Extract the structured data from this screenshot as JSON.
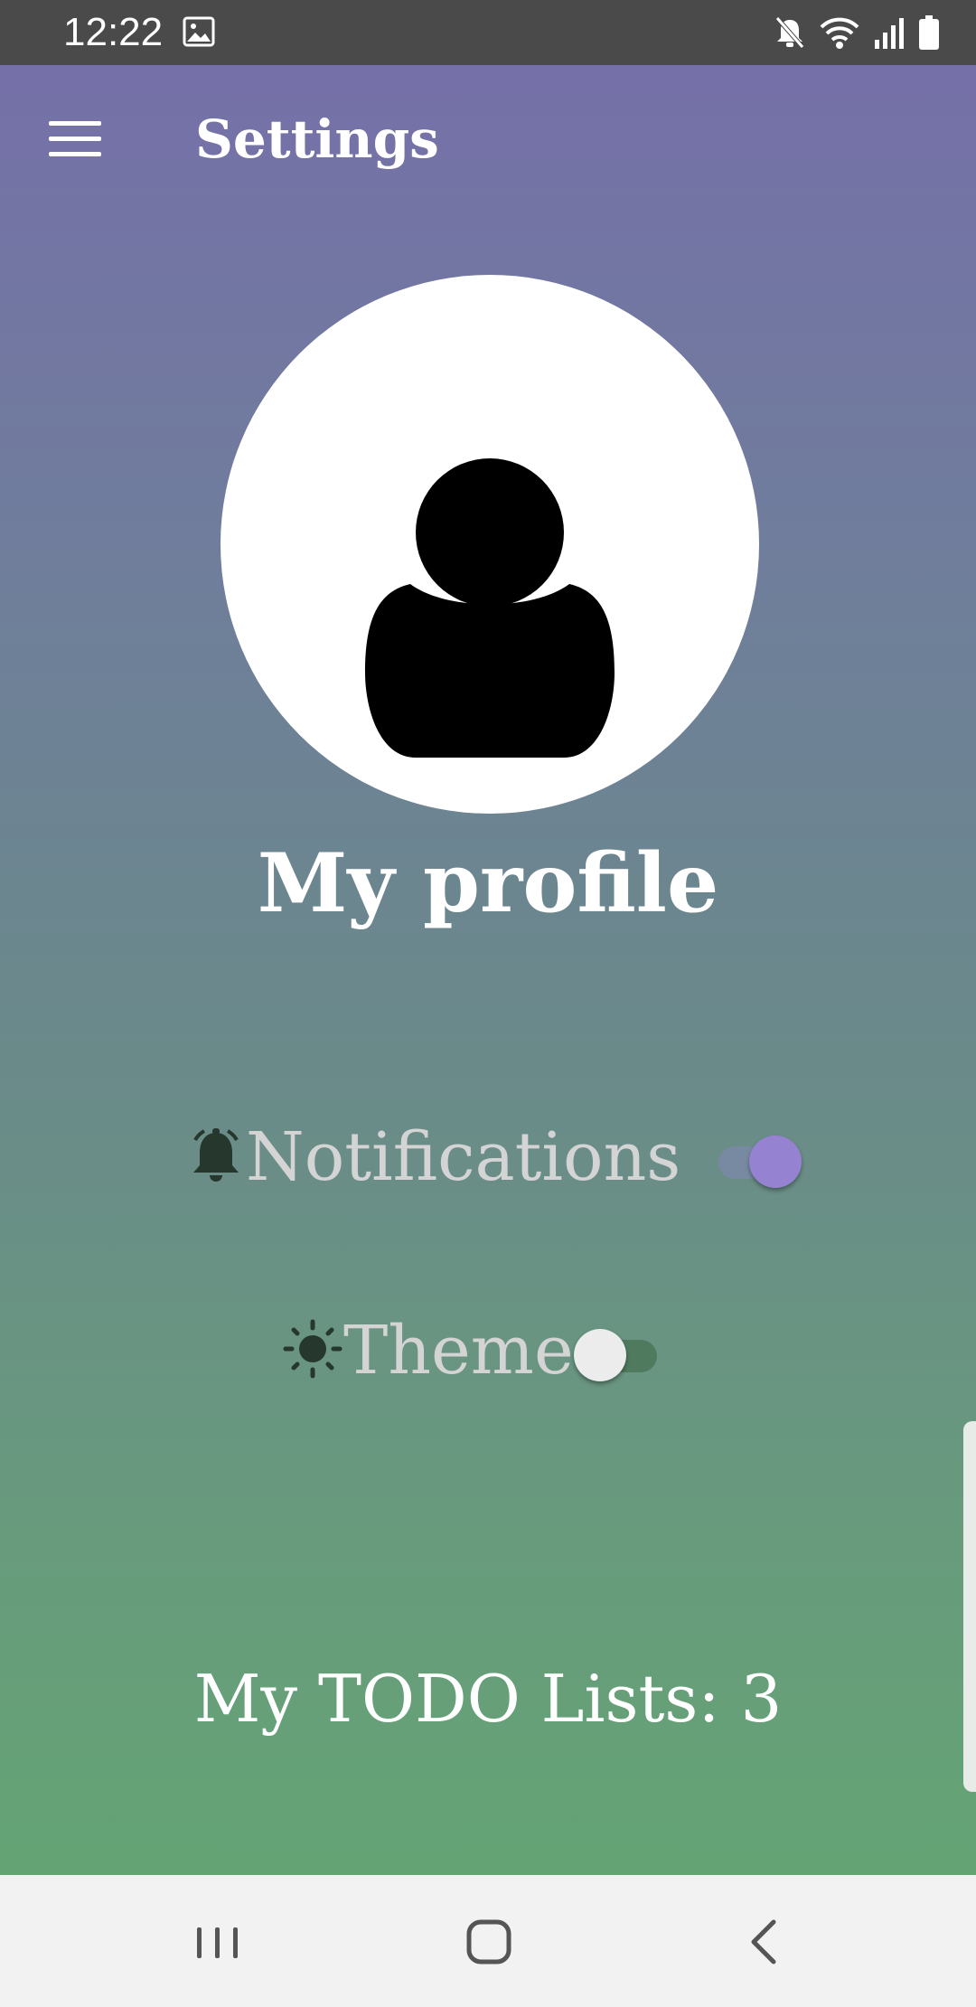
{
  "status_bar": {
    "time": "12:22",
    "icons": [
      "gallery-icon",
      "mute-icon",
      "wifi-icon",
      "signal-icon",
      "battery-icon"
    ]
  },
  "header": {
    "title": "Settings",
    "menu_icon": "hamburger-menu-icon"
  },
  "profile": {
    "avatar_icon": "user-avatar-icon",
    "title": "My profile"
  },
  "settings": {
    "notifications": {
      "label": "Notifications",
      "icon": "bell-icon",
      "enabled": true
    },
    "theme": {
      "label": "Theme",
      "icon": "sun-icon",
      "enabled": false
    }
  },
  "todo": {
    "label": "My TODO Lists: 3"
  },
  "nav_bar": {
    "recents_icon": "recents-icon",
    "home_icon": "home-icon",
    "back_icon": "back-icon"
  },
  "colors": {
    "gradient_top": "#7570a8",
    "gradient_bottom": "#64a474",
    "switch_on_thumb": "#9583d1",
    "label_text": "#d4d4d4"
  }
}
